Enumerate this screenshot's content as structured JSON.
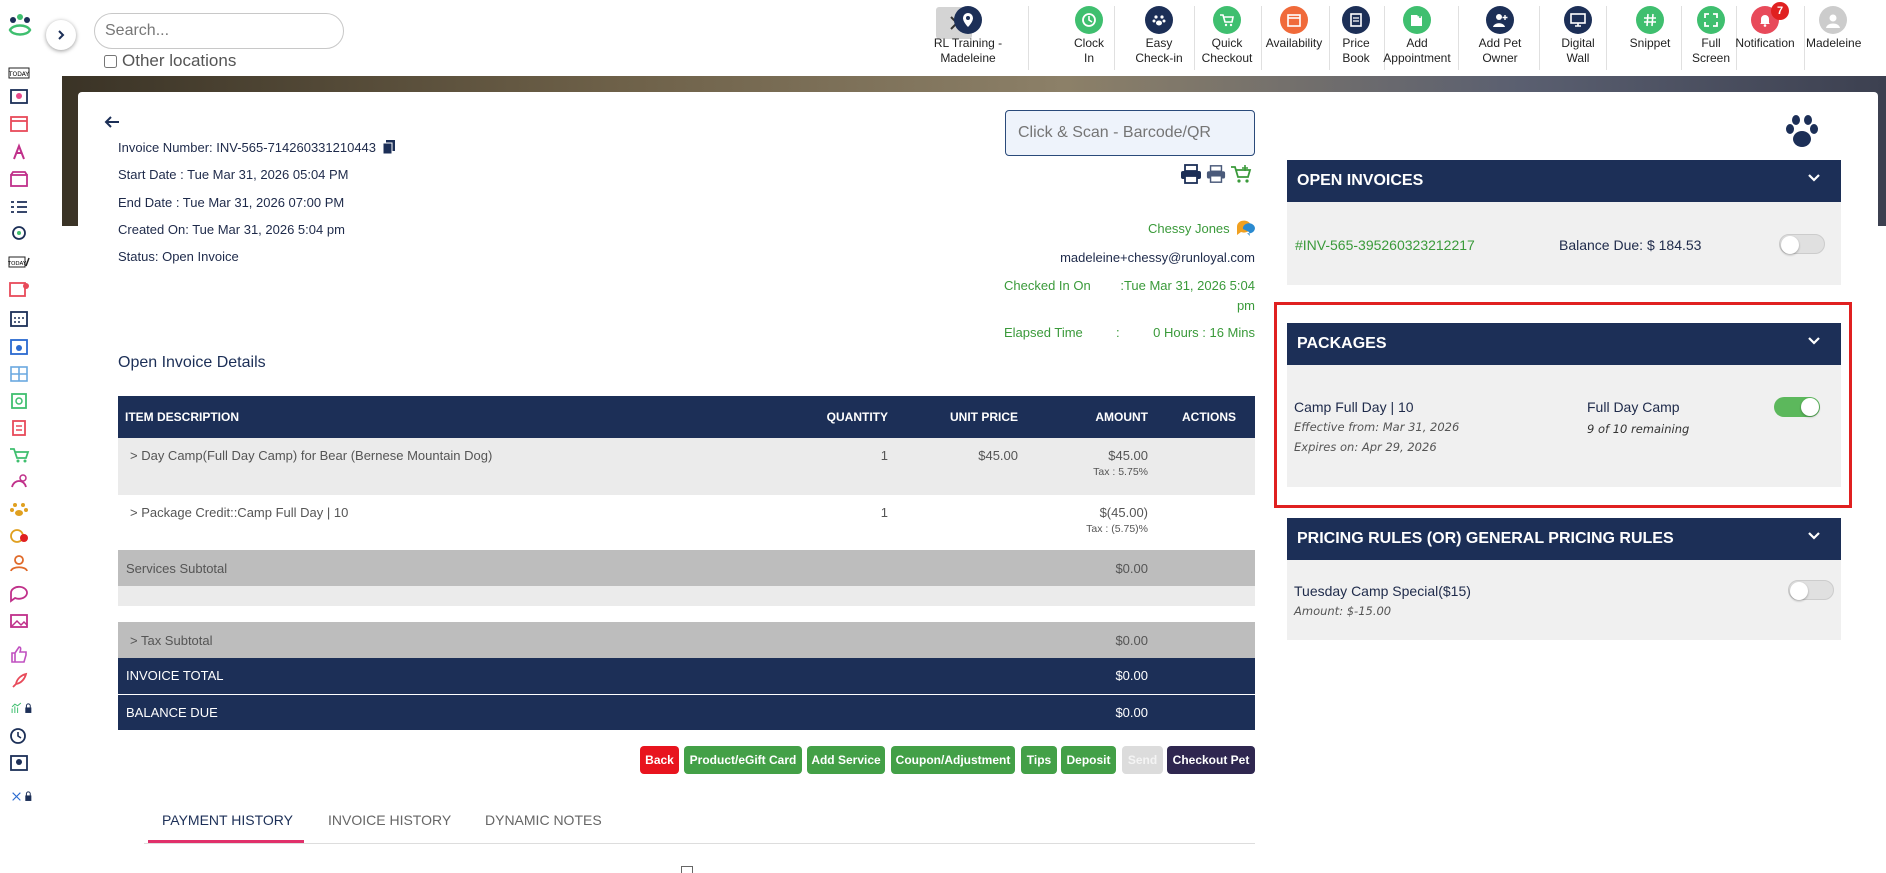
{
  "search": {
    "placeholder": "Search...",
    "other_locations_label": "Other locations"
  },
  "toolbar": [
    {
      "label": "RL Training - Madeleine",
      "icon": "location-pin-icon",
      "color": "#1c2f57"
    },
    {
      "label": "Clock In",
      "icon": "clock-icon",
      "color": "#3fbf6f"
    },
    {
      "label": "Easy Check-in",
      "icon": "paw-icon",
      "color": "#1c2f57"
    },
    {
      "label": "Quick Checkout",
      "icon": "cart-icon",
      "color": "#3fbf6f"
    },
    {
      "label": "Availability",
      "icon": "calendar-icon",
      "color": "#f06a3a"
    },
    {
      "label": "Price Book",
      "icon": "book-icon",
      "color": "#1c2f57"
    },
    {
      "label": "Add Appointment",
      "icon": "add-appointment-icon",
      "color": "#3fbf6f"
    },
    {
      "label": "Add Pet Owner",
      "icon": "add-user-icon",
      "color": "#1c2f57"
    },
    {
      "label": "Digital Wall",
      "icon": "monitor-icon",
      "color": "#1c2f57"
    },
    {
      "label": "Snippet",
      "icon": "hash-icon",
      "color": "#3fbf6f"
    },
    {
      "label": "Full Screen",
      "icon": "fullscreen-icon",
      "color": "#3fbf6f"
    },
    {
      "label": "Notification",
      "icon": "bell-icon",
      "color": "#e84a5a",
      "badge": "7"
    },
    {
      "label": "Madeleine",
      "icon": "avatar-icon",
      "color": "#cccccc"
    }
  ],
  "invoice": {
    "number": "Invoice Number: INV-565-714260331210443",
    "start": "Start Date : Tue Mar 31, 2026 05:04 PM",
    "end": "End Date : Tue Mar 31, 2026 07:00 PM",
    "created": "Created On: Tue Mar 31, 2026 5:04 pm",
    "status": "Status: Open Invoice",
    "scan_placeholder": "Click & Scan - Barcode/QR",
    "customer_name": "Chessy Jones",
    "customer_email": "madeleine+chessy@runloyal.com",
    "checked_in_label": "Checked In On",
    "checked_in_value": ":Tue Mar 31, 2026 5:04",
    "checked_in_value2": "pm",
    "elapsed_label": "Elapsed Time",
    "elapsed_colon": ":",
    "elapsed_value": "0 Hours : 16 Mins",
    "details_title": "Open Invoice Details"
  },
  "table": {
    "headers": [
      "ITEM DESCRIPTION",
      "QUANTITY",
      "UNIT PRICE",
      "AMOUNT",
      "ACTIONS"
    ],
    "rows": [
      {
        "desc": ">  Day Camp(Full Day Camp) for Bear (Bernese Mountain Dog)",
        "qty": "1",
        "unit": "$45.00",
        "amount": "$45.00",
        "tax": "Tax : 5.75%"
      },
      {
        "desc": ">  Package Credit::Camp Full Day | 10",
        "qty": "1",
        "unit": "",
        "amount": "$(45.00)",
        "tax": "Tax : (5.75)%"
      }
    ],
    "services_subtotal_label": "Services Subtotal",
    "services_subtotal": "$0.00",
    "tax_subtotal_label": ">  Tax Subtotal",
    "tax_subtotal": "$0.00",
    "invoice_total_label": "INVOICE TOTAL",
    "invoice_total": "$0.00",
    "balance_due_label": "BALANCE DUE",
    "balance_due": "$0.00"
  },
  "buttons": {
    "back": "Back",
    "product": "Product/eGift Card",
    "add_service": "Add Service",
    "coupon": "Coupon/Adjustment",
    "tips": "Tips",
    "deposit": "Deposit",
    "send": "Send",
    "checkout": "Checkout Pet"
  },
  "tabs": [
    "PAYMENT HISTORY",
    "INVOICE HISTORY",
    "DYNAMIC NOTES"
  ],
  "open_invoices": {
    "title": "OPEN INVOICES",
    "invoice_id": "#INV-565-395260323212217",
    "balance": "Balance Due: $ 184.53",
    "toggle_on": false
  },
  "packages": {
    "title": "PACKAGES",
    "name": "Camp Full Day | 10",
    "effective": "Effective from: Mar 31, 2026",
    "expires": "Expires on: Apr 29, 2026",
    "service": "Full Day Camp",
    "remaining": "9 of 10 remaining",
    "toggle_on": true
  },
  "pricing_rules": {
    "title": "PRICING RULES (OR) GENERAL PRICING RULES",
    "rule": "Tuesday Camp Special($15)",
    "amount": "Amount: $-15.00",
    "toggle_on": false
  },
  "colors": {
    "navy": "#1c2f57",
    "green": "#43a047",
    "red": "#e53935",
    "highlight": "#e02020"
  }
}
